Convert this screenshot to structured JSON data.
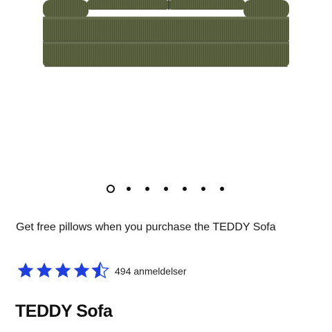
{
  "promo": {
    "text": "Get free pillows when you purchase the TEDDY Sofa"
  },
  "rating": {
    "value": 4.5,
    "max": 5,
    "count_text": "494 anmeldelser",
    "star_color": "#1f3fe0"
  },
  "product": {
    "title": "TEDDY Sofa",
    "color": "#5b6240"
  },
  "carousel": {
    "total": 7,
    "active_index": 0
  }
}
